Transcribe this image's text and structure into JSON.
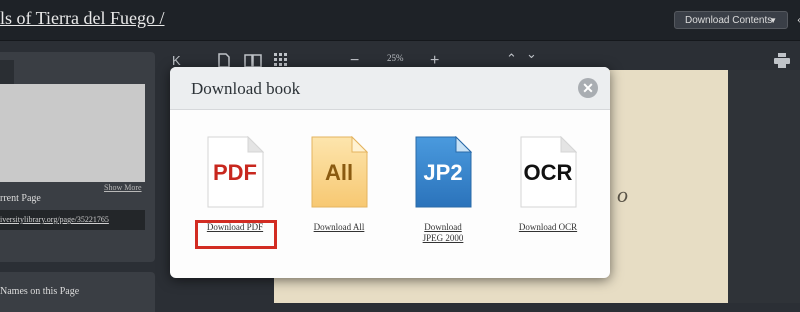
{
  "header": {
    "title": "ls of Tierra del Fuego /",
    "download_contents_label": "Download Contents",
    "caret": "▼",
    "tail": "‹"
  },
  "left_panel": {
    "show_more": "Show More",
    "current_page_label": "rrent Page",
    "current_url": "iversitylibrary.org/page/35221765",
    "names_label": "Names on this Page"
  },
  "viewer_toolbar": {
    "first_page": "K",
    "zoom_out": "−",
    "zoom_level": "25%",
    "zoom_in": "+",
    "prev": "⌃",
    "next": "⌄"
  },
  "page_scribble": "o",
  "modal": {
    "title": "Download book",
    "close_label": "✕",
    "items": [
      {
        "icon_text": "PDF",
        "link": "Download PDF",
        "color": "#c8271e"
      },
      {
        "icon_text": "All",
        "link": "Download All",
        "color": "#8a5a10"
      },
      {
        "icon_text": "JP2",
        "link_line1": "Download",
        "link_line2": "JPEG 2000",
        "color": "#ffffff"
      },
      {
        "icon_text": "OCR",
        "link": "Download OCR",
        "color": "#111111"
      }
    ]
  }
}
